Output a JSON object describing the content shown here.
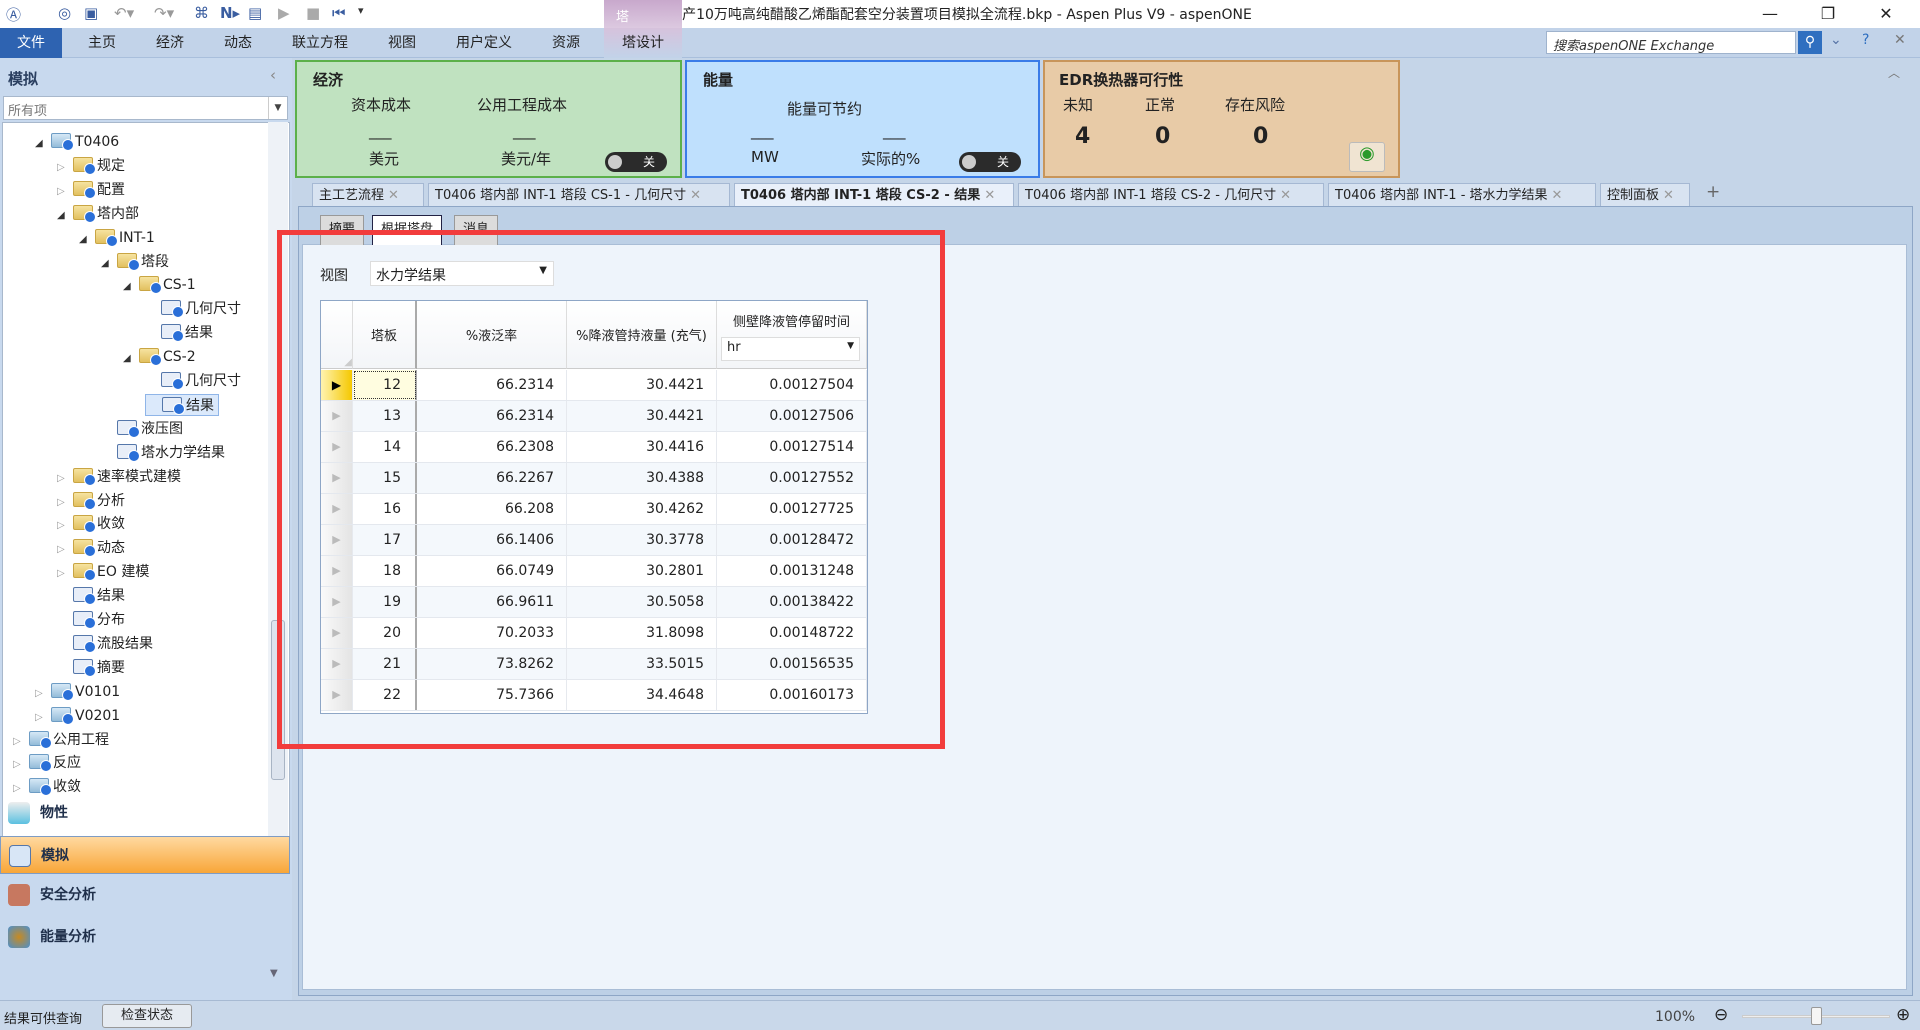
{
  "window": {
    "title": "年产10万吨高纯醋酸乙烯酯配套空分装置项目模拟全流程.bkp - Aspen Plus V9 - aspenONE",
    "minimize": "—",
    "restore": "❐",
    "close": "✕"
  },
  "ribbon": {
    "file": "文件",
    "tabs": [
      "主页",
      "经济",
      "动态",
      "联立方程",
      "视图",
      "用户定义",
      "资源",
      "塔设计"
    ],
    "context_label": "塔",
    "search_placeholder": "搜索aspenONE Exchange"
  },
  "sidebar": {
    "title": "模拟",
    "filter": "所有项",
    "tree": [
      {
        "label": "T0406",
        "level": 0,
        "exp": "open",
        "icon": "bfolder"
      },
      {
        "label": "规定",
        "level": 1,
        "exp": "closed",
        "icon": "folder"
      },
      {
        "label": "配置",
        "level": 1,
        "exp": "closed",
        "icon": "folder"
      },
      {
        "label": "塔内部",
        "level": 1,
        "exp": "open",
        "icon": "folder"
      },
      {
        "label": "INT-1",
        "level": 2,
        "exp": "open",
        "icon": "folder"
      },
      {
        "label": "塔段",
        "level": 3,
        "exp": "open",
        "icon": "folder"
      },
      {
        "label": "CS-1",
        "level": 4,
        "exp": "open",
        "icon": "folder"
      },
      {
        "label": "几何尺寸",
        "level": 5,
        "exp": "",
        "icon": "form"
      },
      {
        "label": "结果",
        "level": 5,
        "exp": "",
        "icon": "form"
      },
      {
        "label": "CS-2",
        "level": 4,
        "exp": "open",
        "icon": "folder"
      },
      {
        "label": "几何尺寸",
        "level": 5,
        "exp": "",
        "icon": "form"
      },
      {
        "label": "结果",
        "level": 5,
        "exp": "",
        "icon": "form",
        "selected": true
      },
      {
        "label": "液压图",
        "level": 3,
        "exp": "",
        "icon": "form"
      },
      {
        "label": "塔水力学结果",
        "level": 3,
        "exp": "",
        "icon": "form"
      },
      {
        "label": "速率模式建模",
        "level": 1,
        "exp": "closed",
        "icon": "folder"
      },
      {
        "label": "分析",
        "level": 1,
        "exp": "closed",
        "icon": "folder"
      },
      {
        "label": "收敛",
        "level": 1,
        "exp": "closed",
        "icon": "folder"
      },
      {
        "label": "动态",
        "level": 1,
        "exp": "closed",
        "icon": "folder"
      },
      {
        "label": "EO 建模",
        "level": 1,
        "exp": "closed",
        "icon": "folder"
      },
      {
        "label": "结果",
        "level": 1,
        "exp": "",
        "icon": "form"
      },
      {
        "label": "分布",
        "level": 1,
        "exp": "",
        "icon": "form"
      },
      {
        "label": "流股结果",
        "level": 1,
        "exp": "",
        "icon": "form"
      },
      {
        "label": "摘要",
        "level": 1,
        "exp": "",
        "icon": "form"
      },
      {
        "label": "V0101",
        "level": 0,
        "exp": "closed",
        "icon": "bfolder"
      },
      {
        "label": "V0201",
        "level": 0,
        "exp": "closed",
        "icon": "bfolder"
      },
      {
        "label": "公用工程",
        "level": -1,
        "exp": "closed",
        "icon": "bfolder"
      },
      {
        "label": "反应",
        "level": -1,
        "exp": "closed",
        "icon": "bfolder"
      },
      {
        "label": "收敛",
        "level": -1,
        "exp": "closed",
        "icon": "bfolder"
      }
    ],
    "nav": [
      "物性",
      "模拟",
      "安全分析",
      "能量分析"
    ]
  },
  "panels": {
    "economics": {
      "title": "经济",
      "capital": "资本成本",
      "utility": "公用工程成本",
      "capital_val": "___",
      "utility_val": "___",
      "capital_unit": "美元",
      "utility_unit": "美元/年",
      "toggle": "关"
    },
    "energy": {
      "title": "能量",
      "savings": "能量可节约",
      "mw_val": "___",
      "pct_val": "___",
      "mw_unit": "MW",
      "pct_unit": "实际的%",
      "toggle": "关"
    },
    "edr": {
      "title": "EDR换热器可行性",
      "unknown": "未知",
      "ok": "正常",
      "risk": "存在风险",
      "unknown_n": "4",
      "ok_n": "0",
      "risk_n": "0"
    }
  },
  "doc_tabs": [
    "主工艺流程",
    "T0406 塔内部 INT-1 塔段 CS-1 - 几何尺寸",
    "T0406 塔内部 INT-1 塔段 CS-2 - 结果",
    "T0406 塔内部 INT-1 塔段 CS-2 - 几何尺寸",
    "T0406 塔内部 INT-1 - 塔水力学结果",
    "控制面板"
  ],
  "sub_tabs": [
    "摘要",
    "根据塔盘",
    "消息"
  ],
  "view": {
    "label": "视图",
    "value": "水力学结果"
  },
  "table": {
    "headers": [
      "塔板",
      "%液泛率",
      "%降液管持液量 (充气)",
      "侧壁降液管停留时间"
    ],
    "unit": "hr",
    "rows": [
      [
        "12",
        "66.2314",
        "30.4421",
        "0.00127504"
      ],
      [
        "13",
        "66.2314",
        "30.4421",
        "0.00127506"
      ],
      [
        "14",
        "66.2308",
        "30.4416",
        "0.00127514"
      ],
      [
        "15",
        "66.2267",
        "30.4388",
        "0.00127552"
      ],
      [
        "16",
        "66.208",
        "30.4262",
        "0.00127725"
      ],
      [
        "17",
        "66.1406",
        "30.3778",
        "0.00128472"
      ],
      [
        "18",
        "66.0749",
        "30.2801",
        "0.00131248"
      ],
      [
        "19",
        "66.9611",
        "30.5058",
        "0.00138422"
      ],
      [
        "20",
        "70.2033",
        "31.8098",
        "0.00148722"
      ],
      [
        "21",
        "73.8262",
        "33.5015",
        "0.00156535"
      ],
      [
        "22",
        "75.7366",
        "34.4648",
        "0.00160173"
      ]
    ]
  },
  "status": {
    "left": "结果可供查询",
    "check": "检查状态",
    "zoom": "100%",
    "zoom_level": 0.5
  }
}
